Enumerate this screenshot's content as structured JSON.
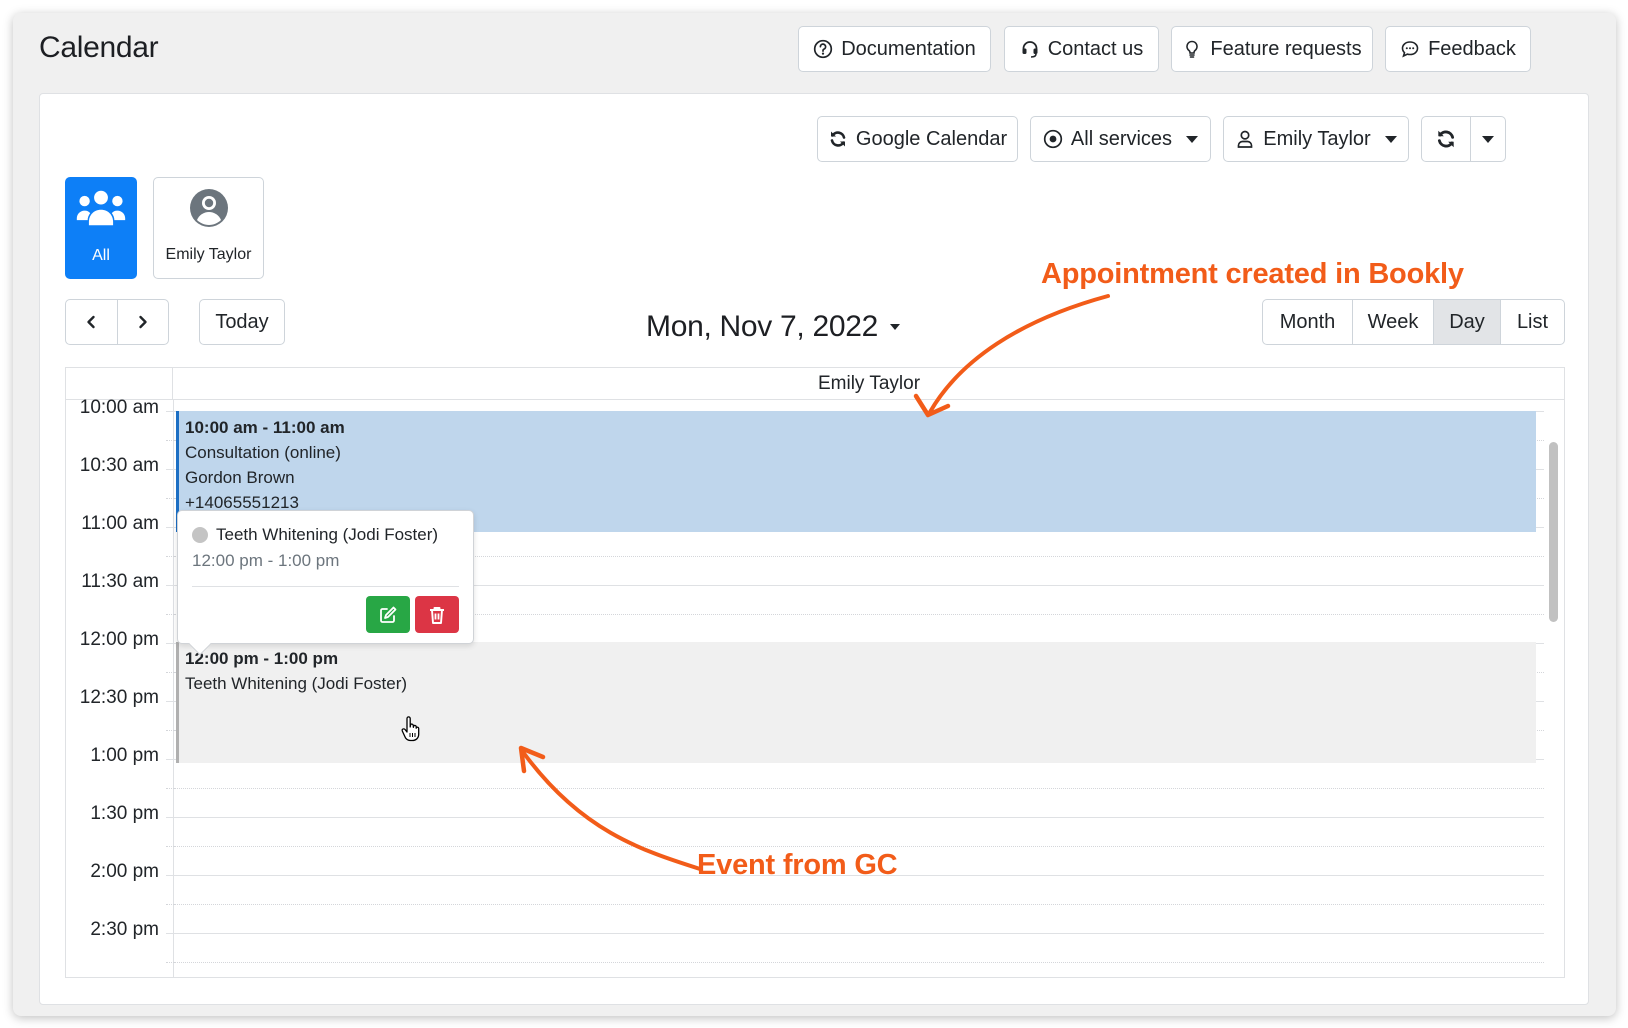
{
  "page": {
    "title": "Calendar"
  },
  "header_buttons": [
    {
      "label": "Documentation",
      "icon": "question-circle-icon"
    },
    {
      "label": "Contact us",
      "icon": "headset-icon"
    },
    {
      "label": "Feature requests",
      "icon": "lightbulb-icon"
    },
    {
      "label": "Feedback",
      "icon": "chat-dots-icon"
    }
  ],
  "toolbar": {
    "google_calendar_label": "Google Calendar",
    "services_label": "All services",
    "staff_label": "Emily Taylor",
    "refresh_icon": "sync-icon",
    "refresh_menu_icon": "caret-down-icon"
  },
  "staff_tiles": [
    {
      "label": "All",
      "icon": "users-icon",
      "active": true
    },
    {
      "label": "Emily Taylor",
      "icon": "user-circle-icon",
      "active": false
    }
  ],
  "navigation": {
    "prev_icon": "chevron-left-icon",
    "next_icon": "chevron-right-icon",
    "today_label": "Today",
    "date_title": "Mon, Nov 7, 2022"
  },
  "views": [
    {
      "label": "Month",
      "active": false
    },
    {
      "label": "Week",
      "active": false
    },
    {
      "label": "Day",
      "active": true
    },
    {
      "label": "List",
      "active": false
    }
  ],
  "calendar": {
    "column_title": "Emily Taylor",
    "time_slots": [
      "10:00 am",
      "10:30 am",
      "11:00 am",
      "11:30 am",
      "12:00 pm",
      "12:30 pm",
      "1:00 pm",
      "1:30 pm",
      "2:00 pm",
      "2:30 pm"
    ],
    "events": [
      {
        "type": "bookly",
        "time": "10:00 am - 11:00 am",
        "service": "Consultation (online)",
        "customer": "Gordon Brown",
        "phone": "+14065551213",
        "color": "#bfd6ec"
      },
      {
        "type": "google",
        "time": "12:00 pm - 1:00 pm",
        "service": "Teeth Whitening (Jodi Foster)",
        "color": "#f0f0f0"
      }
    ]
  },
  "popover": {
    "title": "Teeth Whitening (Jodi Foster)",
    "time": "12:00 pm - 1:00 pm",
    "edit_icon": "edit-icon",
    "delete_icon": "trash-icon"
  },
  "annotations": {
    "bookly": "Appointment created in Bookly",
    "gc": "Event from GC",
    "color": "#f25c19"
  },
  "colors": {
    "primary": "#0d7ff7",
    "success": "#28a745",
    "danger": "#dc3545"
  }
}
